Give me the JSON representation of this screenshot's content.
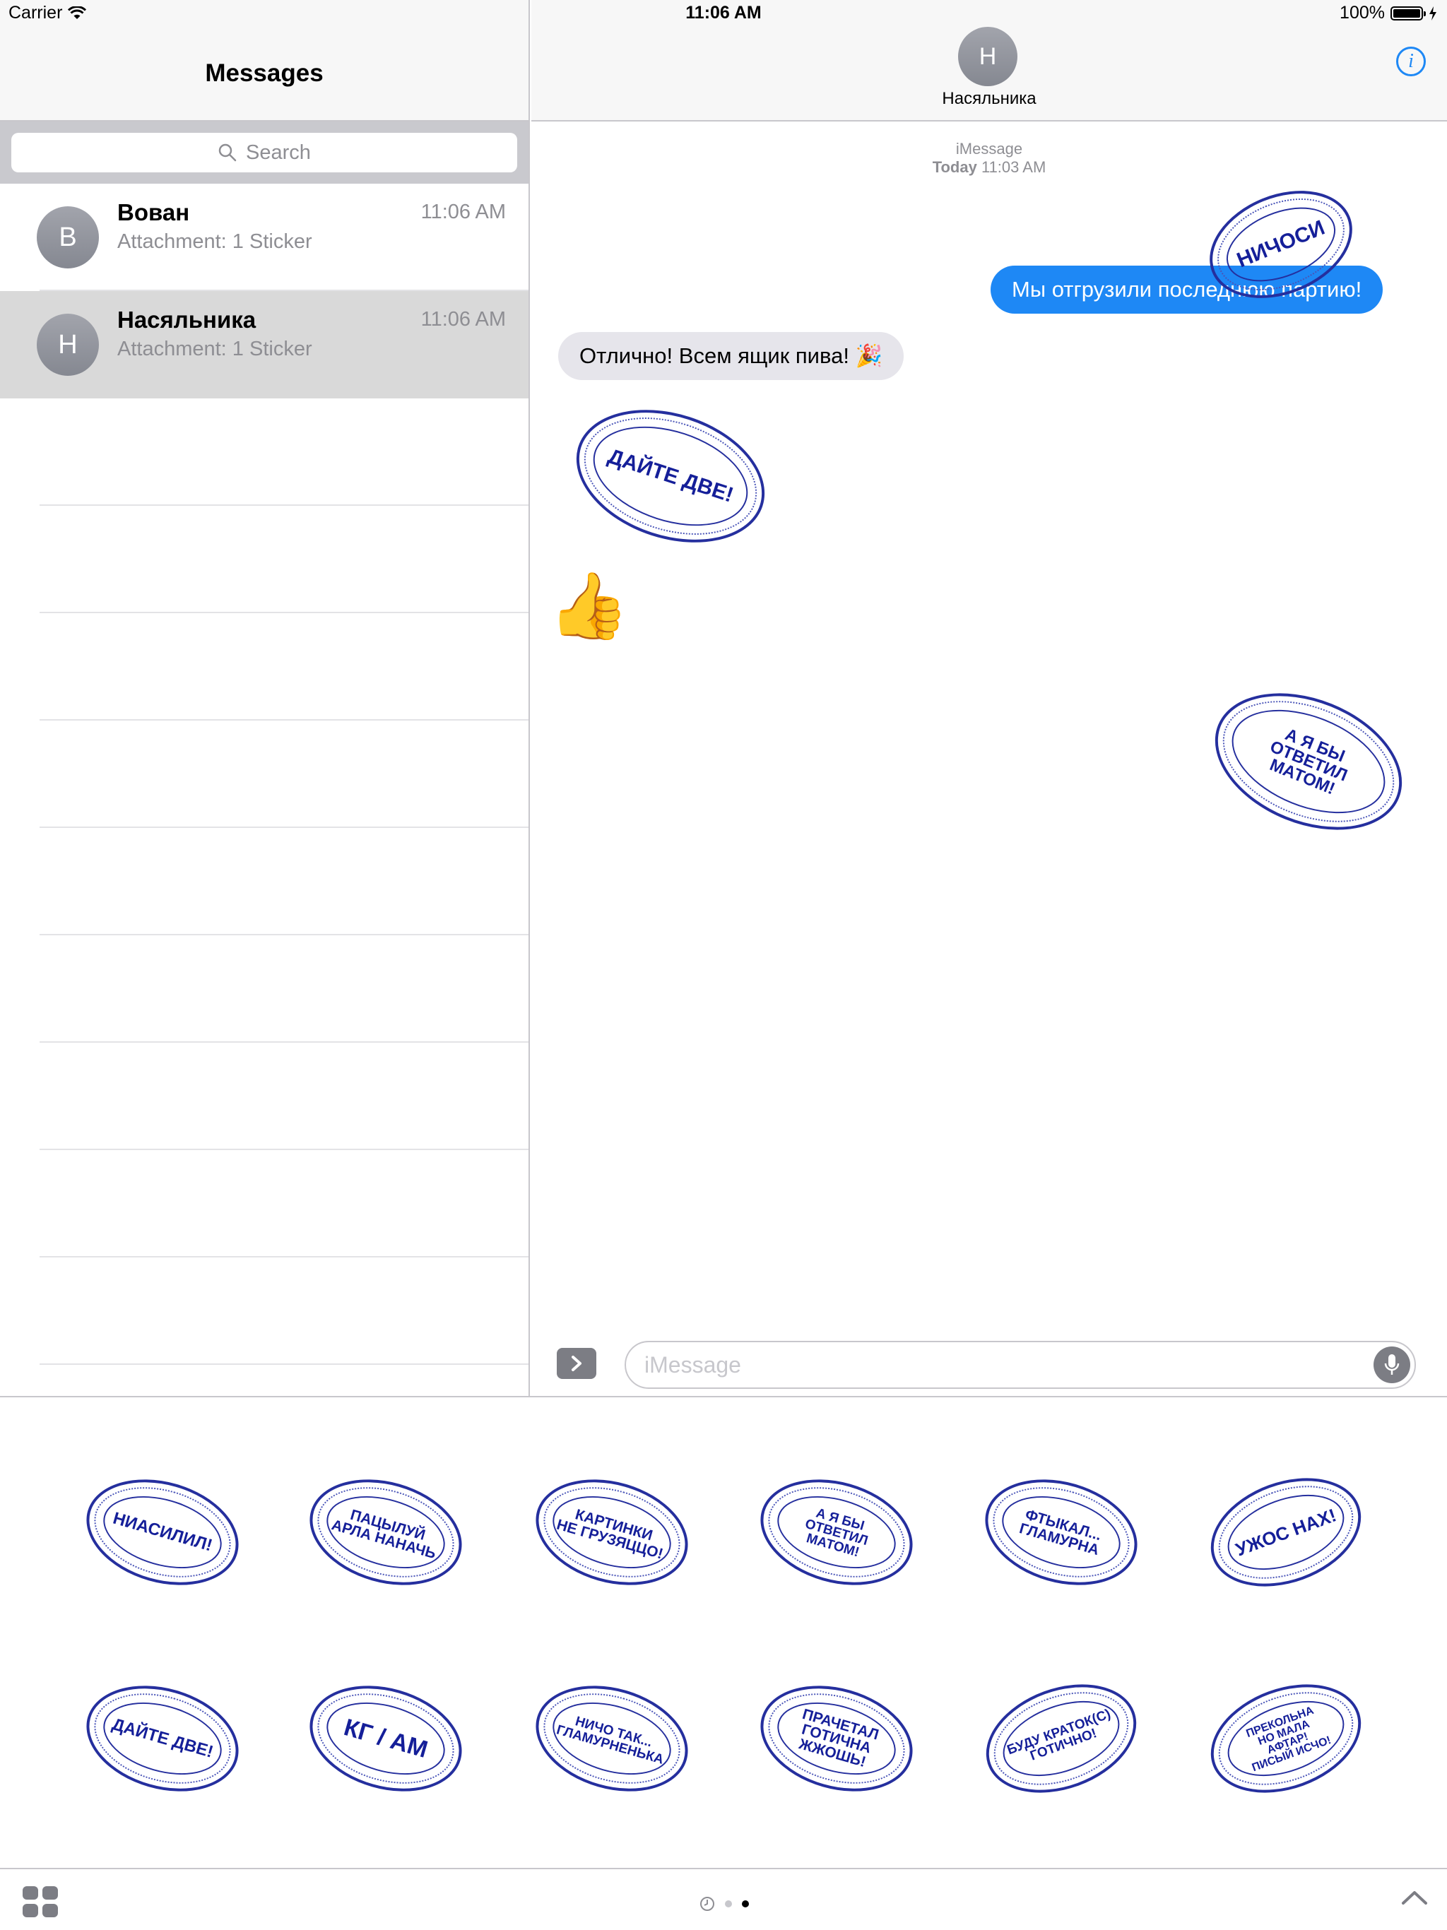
{
  "status_bar": {
    "carrier": "Carrier",
    "time": "11:06 AM",
    "battery": "100%",
    "battery_level": 1.0
  },
  "sidebar": {
    "title": "Messages",
    "search_placeholder": "Search",
    "conversations": [
      {
        "initial": "В",
        "name": "Вован",
        "preview": "Attachment: 1 Sticker",
        "time": "11:06 AM",
        "selected": false
      },
      {
        "initial": "Н",
        "name": "Насяльника",
        "preview": "Attachment: 1 Sticker",
        "time": "11:06 AM",
        "selected": true
      }
    ]
  },
  "chat": {
    "contact_initial": "Н",
    "contact_name": "Насяльника",
    "service": "iMessage",
    "date_label": "Today",
    "date_time": "11:03 AM",
    "messages": {
      "outgoing_text": "Мы отгрузили последнюю партию!",
      "incoming_text": "Отлично! Всем ящик пива! 🎉",
      "thumbs_emoji": "👍"
    },
    "stickers": {
      "on_outgoing": "НИЧОСИ",
      "incoming": "ДАЙТЕ ДВЕ!",
      "outgoing": "А Я БЫ\nОТВЕТИЛ\nМАТОМ!"
    },
    "input_placeholder": "iMessage"
  },
  "sticker_drawer": {
    "stickers": [
      "НИАСИЛИЛ!",
      "ПАЦЫЛУЙ\nАРЛА НАНАЧЬ",
      "КАРТИНКИ\nНЕ ГРУЗЯЦЦО!",
      "А Я БЫ\nОТВЕТИЛ\nМАТОМ!",
      "ФТЫКАЛ...\nГЛАМУРНА",
      "УЖОС НАХ!",
      "ДАЙТЕ ДВЕ!",
      "КГ / АМ",
      "НИЧО ТАК...\nГЛАМУРНЕНЬКА",
      "ПРАЧЕТАЛ\nГОТИЧНА\nЖЖОШЬ!",
      "БУДУ КРАТОК(С)\nГОТИЧНО!",
      "ПРЕКОЛЬНА\nНО МАЛА\nАФТАР!\nПИСЫЙ ИСЧО!"
    ],
    "page_dots": 2,
    "active_dot": 1
  },
  "colors": {
    "accent": "#1e88f5",
    "stamp_ink": "#252f9e",
    "selected_row": "#d9d9d9"
  },
  "icons": [
    "wifi-icon",
    "battery-icon",
    "charging-icon",
    "search-icon",
    "info-icon",
    "apps-chevron-icon",
    "microphone-icon",
    "app-grid-icon",
    "recents-clock-icon",
    "chevron-up-icon"
  ]
}
